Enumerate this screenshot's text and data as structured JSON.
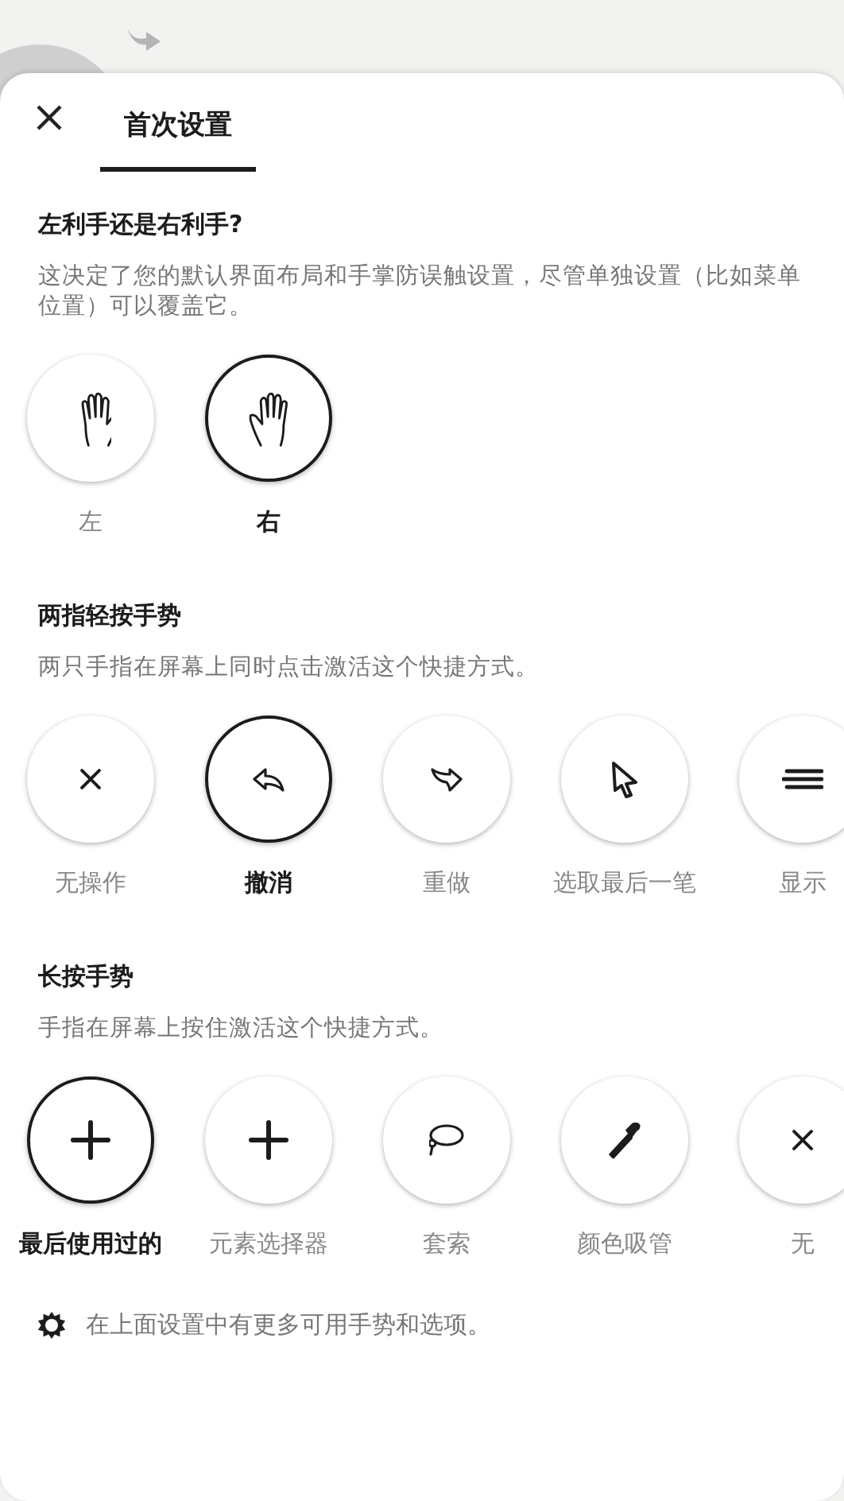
{
  "header": {
    "tabs": [
      {
        "label": "首次设置",
        "selected": true
      }
    ]
  },
  "sections": [
    {
      "title": "左利手还是右利手?",
      "description": "这决定了您的默认界面布局和手掌防误触设置，尽管单独设置（比如菜单位置）可以覆盖它。",
      "options": [
        {
          "label": "左",
          "kind": "hand-left",
          "selected": false
        },
        {
          "label": "右",
          "kind": "hand-right",
          "selected": true
        }
      ]
    },
    {
      "title": "两指轻按手势",
      "description": "两只手指在屏幕上同时点击激活这个快捷方式。",
      "options": [
        {
          "label": "无操作",
          "kind": "none",
          "selected": false
        },
        {
          "label": "撤消",
          "kind": "undo",
          "selected": true
        },
        {
          "label": "重做",
          "kind": "redo",
          "selected": false
        },
        {
          "label": "选取最后一笔",
          "kind": "pointer",
          "selected": false
        },
        {
          "label": "显示",
          "kind": "layers",
          "selected": false
        }
      ]
    },
    {
      "title": "长按手势",
      "description": "手指在屏幕上按住激活这个快捷方式。",
      "options": [
        {
          "label": "最后使用过的",
          "kind": "plus",
          "selected": true
        },
        {
          "label": "元素选择器",
          "kind": "plus",
          "selected": false
        },
        {
          "label": "套索",
          "kind": "lasso",
          "selected": false
        },
        {
          "label": "颜色吸管",
          "kind": "dropper",
          "selected": false
        },
        {
          "label": "无",
          "kind": "none",
          "selected": false
        }
      ]
    }
  ],
  "footer": {
    "text": "在上面设置中有更多可用手势和选项。"
  }
}
